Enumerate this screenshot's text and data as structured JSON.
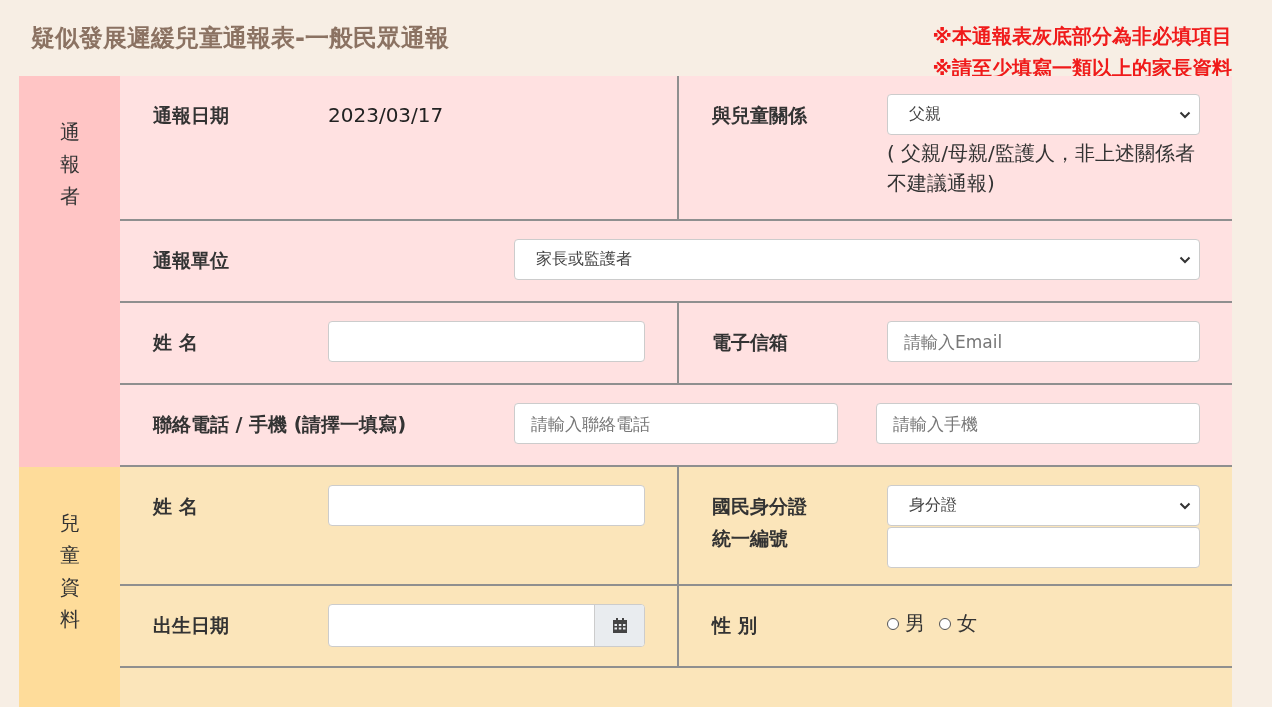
{
  "title": "疑似發展遲緩兒童通報表-一般民眾通報",
  "notices": [
    "※本通報表灰底部分為非必填項目",
    "※請至少填寫一類以上的家長資料"
  ],
  "sections": [
    {
      "kind": "reporter",
      "label": "通報者",
      "rows": [
        [
          {
            "label": "通報日期",
            "fields": [
              {
                "kind": "text",
                "value": "2023/03/17"
              }
            ]
          },
          {
            "label": "與兒童關係",
            "fields": [
              {
                "kind": "select",
                "value": "父親"
              },
              {
                "kind": "note",
                "value": "( 父親/母親/監護人，非上述關係者不建議通報)"
              }
            ]
          }
        ],
        [
          {
            "label": "通報單位",
            "fields": [
              {
                "kind": "select",
                "value": "家長或監護者"
              }
            ]
          }
        ],
        [
          {
            "label": "姓 名",
            "fields": [
              {
                "kind": "input"
              }
            ]
          },
          {
            "label": "電子信箱",
            "fields": [
              {
                "kind": "input",
                "placeholder": "請輸入Email"
              }
            ]
          }
        ],
        [
          {
            "label": "聯絡電話 / 手機 (請擇一填寫)",
            "fields": [
              {
                "kind": "input",
                "placeholder": "請輸入聯絡電話"
              },
              {
                "kind": "input",
                "placeholder": "請輸入手機"
              }
            ]
          }
        ]
      ]
    },
    {
      "kind": "child",
      "label": "兒童資料",
      "rows": [
        [
          {
            "label": "姓 名",
            "fields": [
              {
                "kind": "input"
              }
            ]
          },
          {
            "label": "國民身分證統一編號",
            "fields": [
              {
                "kind": "select",
                "value": "身分證"
              },
              {
                "kind": "input"
              }
            ]
          }
        ],
        [
          {
            "label": "出生日期",
            "fields": [
              {
                "kind": "date"
              }
            ]
          },
          {
            "label": "性 別",
            "fields": [
              {
                "kind": "radio",
                "options": [
                  {
                    "label": "男",
                    "selected": false
                  },
                  {
                    "label": "女",
                    "selected": false
                  }
                ]
              }
            ]
          }
        ]
      ]
    }
  ]
}
